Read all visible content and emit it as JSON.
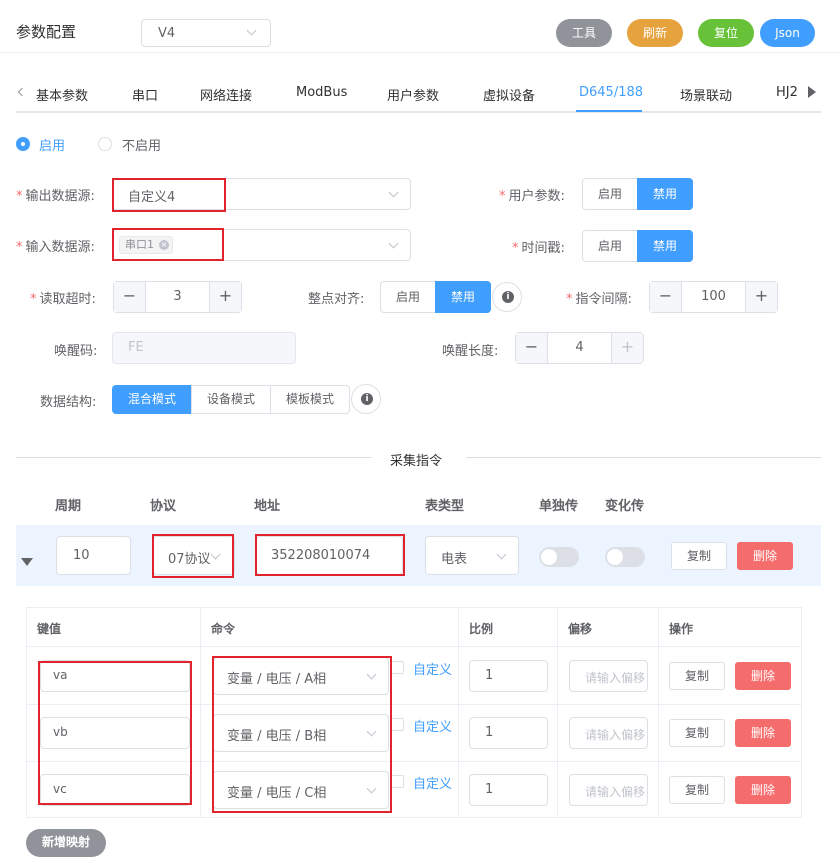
{
  "header": {
    "title": "参数配置",
    "version": "V4",
    "buttons": [
      {
        "label": "工具",
        "color": "#909399"
      },
      {
        "label": "刷新",
        "color": "#e6a23c"
      },
      {
        "label": "复位",
        "color": "#67c23a"
      },
      {
        "label": "Json",
        "color": "#409eff"
      }
    ]
  },
  "tabs": [
    "基本参数",
    "串口",
    "网络连接",
    "ModBus",
    "用户参数",
    "虚拟设备",
    "D645/188",
    "场景联动",
    "HJ2"
  ],
  "active_tab": "D645/188",
  "enable": {
    "on": "启用",
    "off": "不启用"
  },
  "form": {
    "output_source": {
      "label": "输出数据源:",
      "value": "自定义4"
    },
    "input_source": {
      "label": "输入数据源:",
      "tag": "串口1"
    },
    "user_params": {
      "label": "用户参数:",
      "on": "启用",
      "off": "禁用"
    },
    "timestamp": {
      "label": "时间戳:",
      "on": "启用",
      "off": "禁用"
    },
    "read_timeout": {
      "label": "读取超时:",
      "value": "3"
    },
    "align": {
      "label": "整点对齐:",
      "on": "启用",
      "off": "禁用"
    },
    "cmd_interval": {
      "label": "指令间隔:",
      "value": "100"
    },
    "wake_code": {
      "label": "唤醒码:",
      "value": "FE"
    },
    "wake_len": {
      "label": "唤醒长度:",
      "value": "4"
    },
    "structure": {
      "label": "数据结构:",
      "options": [
        "混合模式",
        "设备模式",
        "模板模式"
      ]
    }
  },
  "section_title": "采集指令",
  "cmd_header": [
    "周期",
    "协议",
    "地址",
    "表类型",
    "单独传",
    "变化传"
  ],
  "cmd_row": {
    "period": "10",
    "protocol": "07协议",
    "address": "352208010074",
    "meter": "电表",
    "copy": "复制",
    "delete": "删除"
  },
  "map_header": [
    "键值",
    "命令",
    "比例",
    "偏移",
    "操作"
  ],
  "map_rows": [
    {
      "key": "va",
      "command": "变量 / 电压 / A相",
      "custom": "自定义",
      "ratio": "1",
      "offset_ph": "请输入偏移",
      "copy": "复制",
      "delete": "删除"
    },
    {
      "key": "vb",
      "command": "变量 / 电压 / B相",
      "custom": "自定义",
      "ratio": "1",
      "offset_ph": "请输入偏移",
      "copy": "复制",
      "delete": "删除"
    },
    {
      "key": "vc",
      "command": "变量 / 电压 / C相",
      "custom": "自定义",
      "ratio": "1",
      "offset_ph": "请输入偏移",
      "copy": "复制",
      "delete": "删除"
    }
  ],
  "add_mapping": "新增映射"
}
